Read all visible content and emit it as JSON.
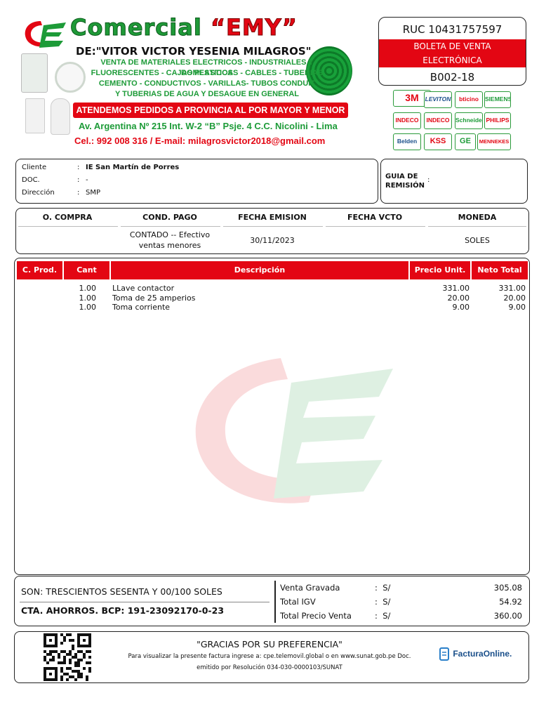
{
  "header": {
    "brand_prefix": "Comercial ",
    "brand_emy": "“EMY”",
    "owner": "DE:\"VITOR VICTOR YESENIA MILAGROS\"",
    "services": [
      "VENTA DE MATERIALES ELECTRICOS - INDUSTRIALES Y DOMESTICOS",
      "FLUORESCENTES - CAJAS PLASTICAS - CABLES - TUBERIAS",
      "CEMENTO - CONDUCTIVOS - VARILLAS- TUBOS CONDUIT",
      "Y TUBERIAS DE AGUA Y DESAGUE EN GENERAL"
    ],
    "banner": "ATENDEMOS PEDIDOS A PROVINCIA AL POR MAYOR Y MENOR",
    "address": "Av. Argentina Nº 215 Int. W-2 “B” Psje. 4 C.C. Nicolini - Lima",
    "contact": "Cel.: 992 008 316 / E-mail: milagrosvictor2018@gmail.com",
    "logo_text": "CE",
    "brand_color": "#1d9b38",
    "accent_color": "#e30613"
  },
  "doc": {
    "ruc": "RUC 10431757597",
    "type_line1": "BOLETA DE VENTA",
    "type_line2": "ELECTRÓNICA",
    "number": "B002-18"
  },
  "brands": [
    "3M",
    "LEVITON",
    "bticino",
    "SIEMENS",
    "INDECO",
    "INDECO",
    "Schneider",
    "PHILIPS",
    "Belden",
    "KSS",
    "GE",
    "MENNEKES"
  ],
  "client": {
    "cliente_label": "Cliente",
    "cliente_value": "IE San Martín de Porres",
    "doc_label": "DOC.",
    "doc_value": "-",
    "direccion_label": "Dirección",
    "direccion_value": "SMP",
    "sep": ":",
    "guia_label_1": "GUIA DE",
    "guia_label_2": "REMISIÓN",
    "guia_value": ":"
  },
  "info": {
    "headers": [
      "O. COMPRA",
      "COND. PAGO",
      "FECHA EMISION",
      "FECHA VCTO",
      "MONEDA"
    ],
    "compra": "",
    "cond_pago_1": "CONTADO -- Efectivo",
    "cond_pago_2": "ventas menores",
    "fecha_emision": "30/11/2023",
    "fecha_vcto": "",
    "moneda": "SOLES"
  },
  "items": {
    "headers": [
      "C. Prod.",
      "Cant",
      "Descripción",
      "Precio Unit.",
      "Neto Total"
    ],
    "rows": [
      {
        "cod": "",
        "cant": "1.00",
        "desc": "LLave contactor",
        "precio": "331.00",
        "neto": "331.00"
      },
      {
        "cod": "",
        "cant": "1.00",
        "desc": "Toma de 25 amperios",
        "precio": "20.00",
        "neto": "20.00"
      },
      {
        "cod": "",
        "cant": "1.00",
        "desc": "Toma corriente",
        "precio": "9.00",
        "neto": "9.00"
      }
    ]
  },
  "totals": {
    "son": "SON: TRESCIENTOS SESENTA Y 00/100 SOLES",
    "cta": "CTA. AHORROS. BCP: 191-23092170-0-23",
    "rows": [
      {
        "label": "Venta Gravada",
        "sep": ":",
        "cur": "S/",
        "value": "305.08"
      },
      {
        "label": "Total IGV",
        "sep": ":",
        "cur": "S/",
        "value": "54.92"
      },
      {
        "label": "Total Precio Venta",
        "sep": ":",
        "cur": "S/",
        "value": "360.00"
      }
    ]
  },
  "footer": {
    "thanks": "\"GRACIAS POR SU PREFERENCIA\"",
    "note1": "Para visualizar la presente factura ingrese a: cpe.telemovil.global o en www.sunat.gob.pe Doc.",
    "note2": "emitido por Resolución 034-030-0000103/SUNAT",
    "provider": "FacturaOnline."
  }
}
